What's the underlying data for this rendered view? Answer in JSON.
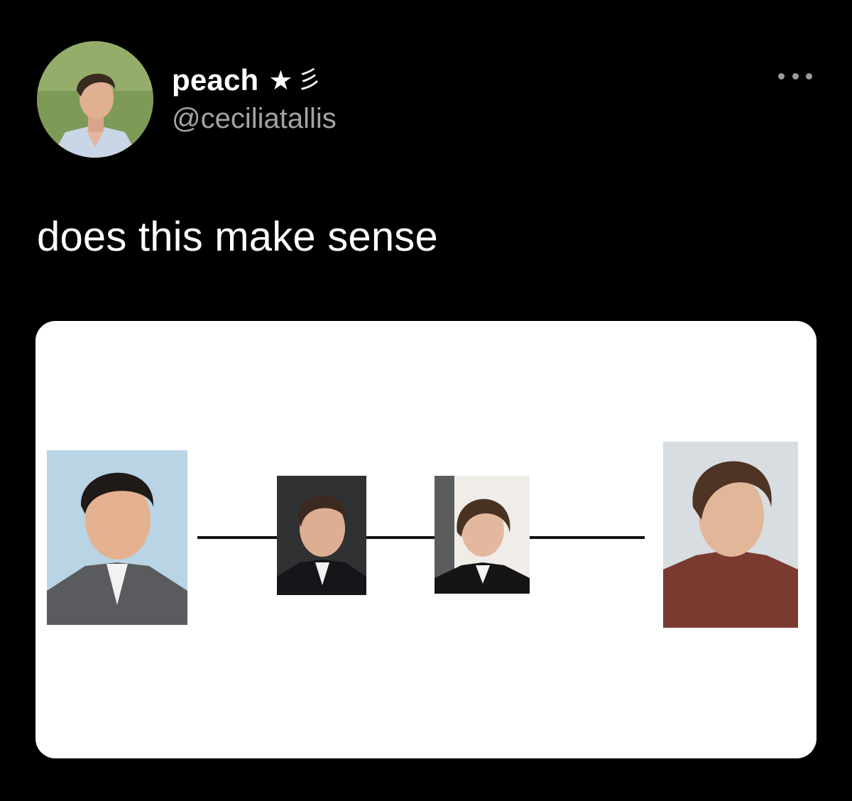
{
  "tweet": {
    "display_name": "peach",
    "name_emoji_1": "★",
    "name_emoji_2": "彡",
    "handle": "@ceciliatallis",
    "text": "does this make sense"
  },
  "icons": {
    "more": "more-options-icon"
  },
  "media": {
    "type": "image-diagram",
    "description_nodes": 4
  },
  "colors": {
    "background": "#000000",
    "text_primary": "#ffffff",
    "text_secondary": "#a4a4a4",
    "card_background": "#ffffff",
    "connector": "#111111"
  }
}
